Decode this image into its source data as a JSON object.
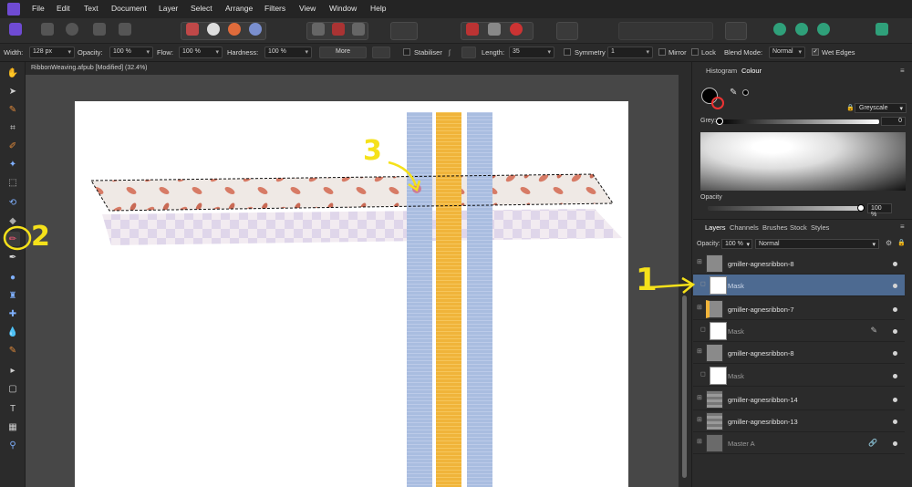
{
  "menubar": {
    "items": [
      "File",
      "Edit",
      "Text",
      "Document",
      "Layer",
      "Select",
      "Arrange",
      "Filters",
      "View",
      "Window",
      "Help"
    ]
  },
  "contextbar": {
    "width_label": "Width:",
    "width_value": "128 px",
    "opacity_label": "Opacity:",
    "opacity_value": "100 %",
    "flow_label": "Flow:",
    "flow_value": "100 %",
    "hardness_label": "Hardness:",
    "hardness_value": "100 %",
    "more_label": "More",
    "stabiliser_label": "Stabiliser",
    "length_label": "Length:",
    "length_value": "35",
    "symmetry_label": "Symmetry",
    "symmetry_value": "1",
    "mirror_label": "Mirror",
    "lock_label": "Lock",
    "blend_label": "Blend Mode:",
    "blend_value": "Normal",
    "wet_edges_label": "Wet Edges"
  },
  "document": {
    "tab_title": "RibbonWeaving.afpub [Modified] (32.4%)"
  },
  "colour_panel": {
    "tab_histogram": "Histogram",
    "tab_colour": "Colour",
    "mode": "Greyscale",
    "grey_label": "Grey:",
    "grey_value": "0",
    "opacity_label": "Opacity",
    "opacity_value": "100 %"
  },
  "layers_panel": {
    "tabs": [
      "Layers",
      "Channels",
      "Brushes",
      "Stock",
      "Styles"
    ],
    "opacity_label": "Opacity:",
    "opacity_value": "100 %",
    "blend_value": "Normal",
    "layers": [
      {
        "name": "gmiller-agnesribbon-8",
        "type": "layer",
        "selected": false
      },
      {
        "name": "Mask",
        "type": "mask",
        "selected": true
      },
      {
        "name": "gmiller-agnesribbon-7",
        "type": "layer",
        "selected": false
      },
      {
        "name": "Mask",
        "type": "mask",
        "selected": false
      },
      {
        "name": "gmiller-agnesribbon-8",
        "type": "layer",
        "selected": false
      },
      {
        "name": "Mask",
        "type": "mask",
        "selected": false
      },
      {
        "name": "gmiller-agnesribbon-14",
        "type": "layer",
        "selected": false
      },
      {
        "name": "gmiller-agnesribbon-13",
        "type": "layer",
        "selected": false
      },
      {
        "name": "Master A",
        "type": "master",
        "selected": false
      }
    ]
  },
  "annotations": {
    "one": "1",
    "two": "2",
    "three": "3"
  },
  "colors": {
    "accent_selection": "#4d6a91",
    "annotation": "#f5e11a",
    "ribbon_blue": "#a9bde0",
    "ribbon_yellow": "#f0b43a"
  }
}
